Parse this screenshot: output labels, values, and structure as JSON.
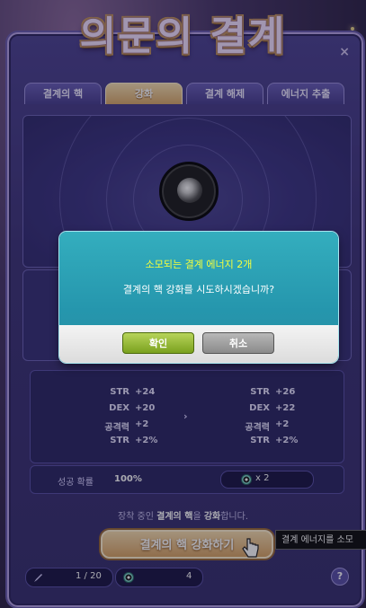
{
  "window": {
    "title": "의문의 결계",
    "close_symbol": "×"
  },
  "tabs": [
    {
      "label": "결계의 핵",
      "active": false
    },
    {
      "label": "강화",
      "active": true
    },
    {
      "label": "결계 해제",
      "active": false
    },
    {
      "label": "에너지 추출",
      "active": false
    }
  ],
  "stats": {
    "before": [
      {
        "key": "STR",
        "value": "+24"
      },
      {
        "key": "DEX",
        "value": "+20"
      },
      {
        "key": "공격력",
        "value": "+2"
      },
      {
        "key": "STR",
        "value": "+2%"
      }
    ],
    "after": [
      {
        "key": "STR",
        "value": "+26"
      },
      {
        "key": "DEX",
        "value": "+22"
      },
      {
        "key": "공격력",
        "value": "+2"
      },
      {
        "key": "STR",
        "value": "+2%"
      }
    ],
    "arrow": "›"
  },
  "success": {
    "label": "성공 확률",
    "value": "100%",
    "cost_text": "x  2"
  },
  "hint": {
    "prefix": "장착 중인 ",
    "bold": "결계의 핵",
    "middle": "을 ",
    "bold2": "강화",
    "suffix": "합니다."
  },
  "enhance_button": {
    "label": "결계의 핵 강화하기"
  },
  "tooltip": {
    "text": "결계 에너지를 소모"
  },
  "footer": {
    "core_count": "1 / 20",
    "energy_count": "4",
    "help": "?"
  },
  "dialog": {
    "title": "소모되는 결계 에너지 2개",
    "message": "결계의 핵 강화를 시도하시겠습니까?",
    "ok_label": "확인",
    "cancel_label": "취소"
  },
  "colors": {
    "accent_gold": "#d9a96a",
    "dialog_teal": "#2596ad",
    "dialog_title": "#f6ff3c",
    "ok_green": "#7aa11e"
  }
}
